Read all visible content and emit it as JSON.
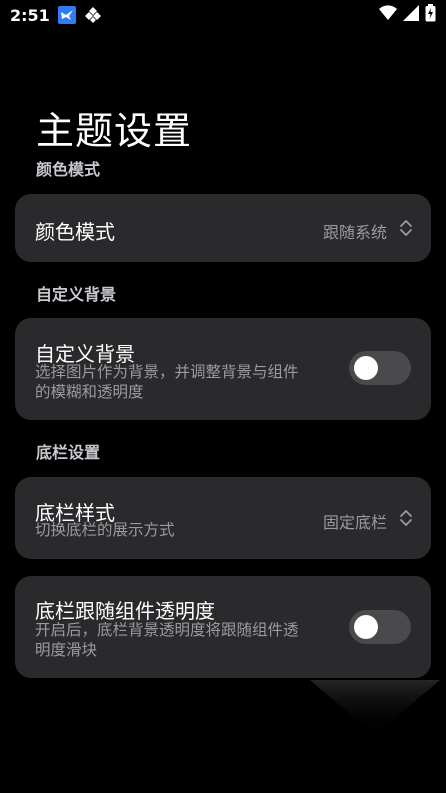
{
  "status_bar": {
    "time": "2:51"
  },
  "page": {
    "title": "主题设置"
  },
  "sections": {
    "color": {
      "header": "颜色模式",
      "row_title": "颜色模式",
      "row_value": "跟随系统"
    },
    "background": {
      "header": "自定义背景",
      "row_title": "自定义背景",
      "row_sub_line1": "选择图片作为背景，并调整背景与组件",
      "row_sub_line2": "的模糊和透明度"
    },
    "bottom_bar": {
      "header": "底栏设置",
      "style_title": "底栏样式",
      "style_sub": "切换底栏的展示方式",
      "style_value": "固定底栏",
      "follow_title": "底栏跟随组件透明度",
      "follow_sub_line1": "开启后，底栏背景透明度将跟随组件透",
      "follow_sub_line2": "明度滑块"
    }
  },
  "colors": {
    "background": "#000000",
    "card": "#2a2a2c",
    "secondary_text": "#9a9aa0",
    "toggle_off": "#4a4a4d"
  }
}
